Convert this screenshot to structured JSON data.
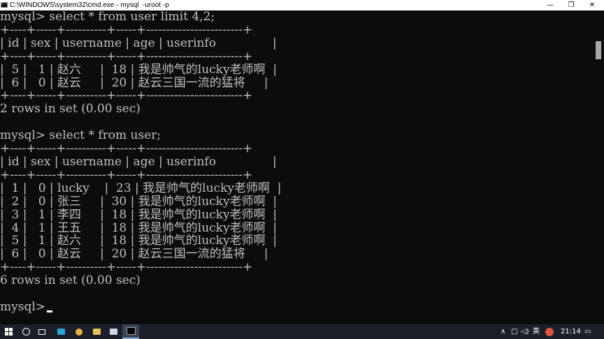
{
  "window": {
    "title": "C:\\WINDOWS\\system32\\cmd.exe - mysql  -uroot -p",
    "minimize": "—",
    "maximize": "❐",
    "close": "✕"
  },
  "console": {
    "lines": [
      "mysql> select * from user limit 4,2;",
      "+----+-----+----------+-----+------------------------+",
      "| id | sex | username | age | userinfo               |",
      "+----+-----+----------+-----+------------------------+",
      "|  5 |   1 | 赵六     |  18 | 我是帅气的lucky老师啊  |",
      "|  6 |   0 | 赵云     |  20 | 赵云三国一流的猛将     |",
      "+----+-----+----------+-----+------------------------+",
      "2 rows in set (0.00 sec)",
      "",
      "mysql> select * from user;",
      "+----+-----+----------+-----+------------------------+",
      "| id | sex | username | age | userinfo               |",
      "+----+-----+----------+-----+------------------------+",
      "|  1 |   0 | lucky    |  23 | 我是帅气的lucky老师啊  |",
      "|  2 |   0 | 张三     |  30 | 我是帅气的lucky老师啊  |",
      "|  3 |   1 | 李四     |  18 | 我是帅气的lucky老师啊  |",
      "|  4 |   1 | 王五     |  18 | 我是帅气的lucky老师啊  |",
      "|  5 |   1 | 赵六     |  18 | 我是帅气的lucky老师啊  |",
      "|  6 |   0 | 赵云     |  20 | 赵云三国一流的猛将     |",
      "+----+-----+----------+-----+------------------------+",
      "6 rows in set (0.00 sec)",
      "",
      "mysql> "
    ],
    "text_color": "#c0c0c0",
    "background": "#0c0c0c"
  },
  "taskbar": {
    "start_icon": "windows-logo-icon",
    "search_icon": "search-icon",
    "taskview_icon": "task-view-icon",
    "apps": [
      {
        "name": "app-icon",
        "color": "#2aa3d8"
      },
      {
        "name": "browser-icon",
        "color": "#e8b03a"
      },
      {
        "name": "folder-icon",
        "color": "#e6c15a"
      },
      {
        "name": "notepad-icon",
        "color": "#cfd8e3"
      },
      {
        "name": "cmd-icon",
        "color": "#000000"
      }
    ],
    "tray": {
      "chevron": "∧",
      "message": "□",
      "volume": "◁)",
      "language": "英",
      "clock": "21:14",
      "notify": "▭"
    }
  }
}
